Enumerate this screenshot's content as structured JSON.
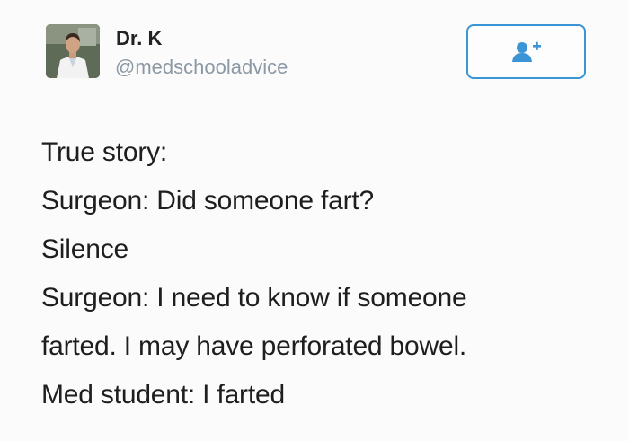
{
  "author": {
    "display_name": "Dr. K",
    "handle": "@medschooladvice"
  },
  "follow_button": {
    "icon": "follow-user-icon",
    "accent_color": "#3a94d6"
  },
  "tweet": {
    "lines": [
      "True story:",
      "Surgeon: Did someone fart?",
      "Silence",
      "Surgeon: I need to know if someone",
      "farted. I may have perforated bowel.",
      "Med student: I farted"
    ]
  }
}
